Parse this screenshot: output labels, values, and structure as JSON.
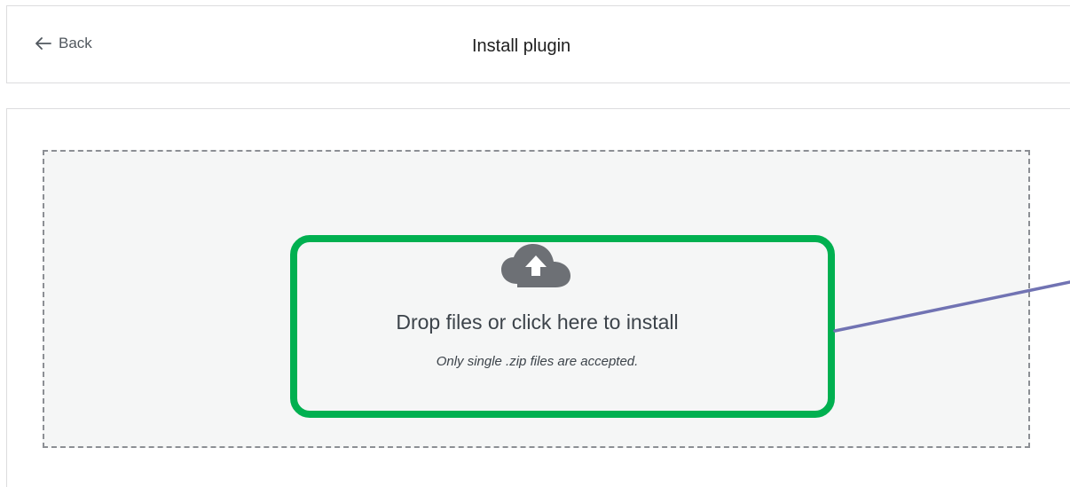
{
  "header": {
    "back_label": "Back",
    "title": "Install plugin"
  },
  "dropzone": {
    "title": "Drop files or click here to install",
    "hint": "Only single .zip files are accepted.",
    "icon": "cloud-upload-icon"
  },
  "colors": {
    "highlight": "#00b050",
    "annotation_line": "#7173b3",
    "upload_icon": "#6d7075"
  }
}
